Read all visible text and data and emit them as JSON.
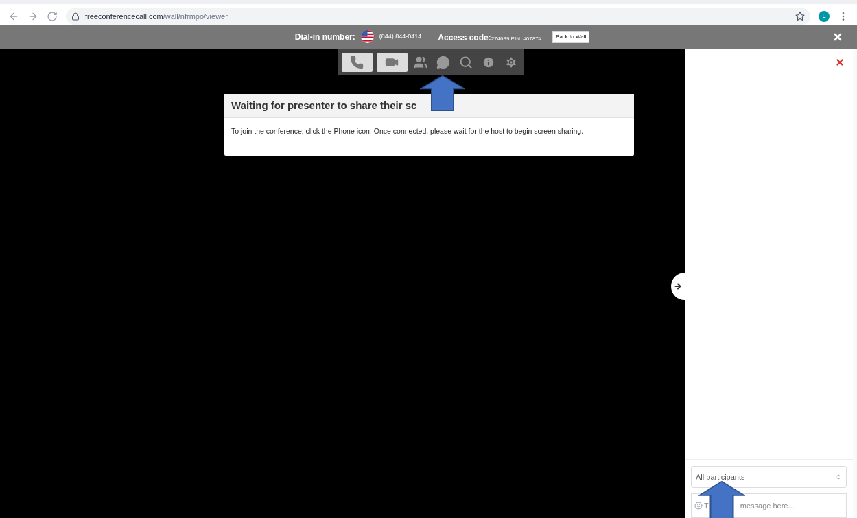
{
  "browser": {
    "url_host": "freeconferencecall.com",
    "url_path": "/wall/nfrmpo/viewer",
    "profile_initial": "L"
  },
  "header": {
    "dial_in_label": "Dial-in number:",
    "dial_in_number": "(844) 844-0414",
    "access_label": "Access code:",
    "access_value": "274639 PIN: #6787#",
    "back_button": "Back to Wall"
  },
  "toolbar": [
    {
      "kind": "phone",
      "boxed": true
    },
    {
      "kind": "video",
      "boxed": true
    },
    {
      "kind": "people",
      "boxed": false
    },
    {
      "kind": "chat",
      "boxed": false
    },
    {
      "kind": "search",
      "boxed": false
    },
    {
      "kind": "info",
      "boxed": false
    },
    {
      "kind": "settings",
      "boxed": false
    }
  ],
  "dialog": {
    "title": "Waiting for presenter to share their sc",
    "body": "To join the conference, click the Phone icon. Once connected, please wait for the host to begin screen sharing."
  },
  "chat_panel": {
    "recipient": "All participants",
    "message_hint_parts": [
      "T",
      "message here..."
    ]
  }
}
